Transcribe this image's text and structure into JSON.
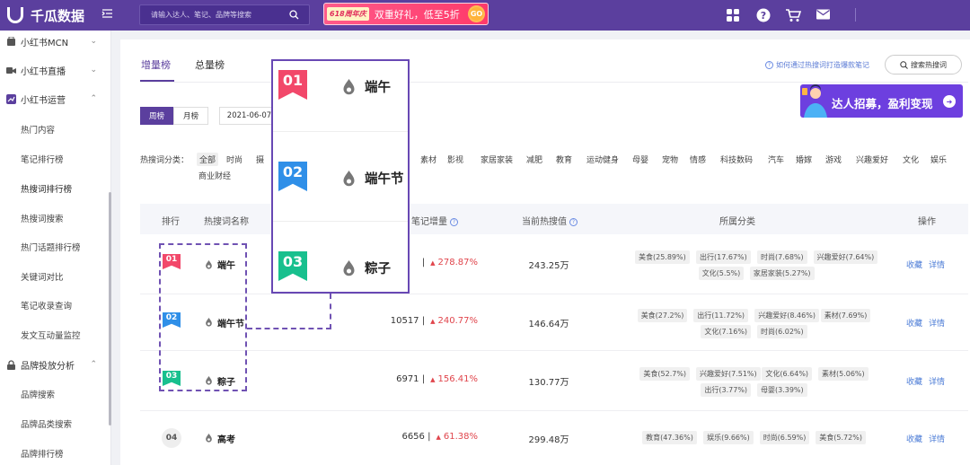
{
  "topbar": {
    "brand": "千瓜数据",
    "search_placeholder": "请输入达人、笔记、品牌等搜索",
    "promo_tag": "618周年庆",
    "promo_text": "双重好礼，低至5折",
    "promo_go": "GO",
    "icons": [
      "collapse-icon",
      "search-icon",
      "apps-icon",
      "help-icon",
      "cart-icon",
      "mail-icon"
    ]
  },
  "sidebar": {
    "groups": [
      {
        "label": "小红书MCN",
        "icon": "mcn-icon",
        "chevron": "⌄"
      },
      {
        "label": "小红书直播",
        "icon": "video-icon",
        "chevron": "⌄"
      },
      {
        "label": "小红书运营",
        "icon": "chart-icon",
        "chevron": "⌃"
      },
      {
        "label": "品牌投放分析",
        "icon": "lock-icon",
        "chevron": "⌃"
      }
    ],
    "items": [
      "热门内容",
      "笔记排行榜",
      "热搜词排行榜",
      "热搜词搜索",
      "热门话题排行榜",
      "关键词对比",
      "笔记收录查询",
      "发文互动量监控",
      "品牌搜索",
      "品牌品类搜索",
      "品牌排行榜"
    ]
  },
  "main": {
    "tabs": [
      "增量榜",
      "总量榜"
    ],
    "howto": "如何通过热搜词打造爆款笔记",
    "hot_search_btn": "搜索热搜词",
    "period": {
      "week": "周榜",
      "month": "月榜",
      "date": "2021-06-07"
    },
    "banner_text": "达人招募，盈利变现",
    "category_label": "热搜词分类：",
    "categories_left": [
      "全部",
      "时尚",
      "摄"
    ],
    "categories_right": [
      "素材",
      "影视",
      "家居家装",
      "减肥",
      "教育",
      "运动健身",
      "母婴",
      "宠物",
      "情感",
      "科技数码",
      "汽车",
      "婚嫁",
      "游戏",
      "兴趣爱好",
      "文化",
      "娱乐"
    ],
    "categories_row2": [
      "商业财经"
    ],
    "headers": {
      "rank": "排行",
      "keyword": "热搜词名称",
      "notes": "笔记增量",
      "heat": "当前热搜值",
      "category": "所属分类",
      "action": "操作"
    },
    "rows": [
      {
        "rank": "01",
        "color": "#f2486a",
        "keyword": "端午",
        "notes": "",
        "pct": "278.87%",
        "heat": "243.25万",
        "chips": [
          [
            "美食(25.89%)",
            "出行(17.67%)",
            "时尚(7.68%)",
            "兴趣爱好(7.64%)"
          ],
          [
            "文化(5.5%)",
            "家居家装(5.27%)"
          ]
        ]
      },
      {
        "rank": "02",
        "color": "#2f8fe8",
        "keyword": "端午节",
        "notes": "10517",
        "pct": "240.77%",
        "heat": "146.64万",
        "chips": [
          [
            "美食(27.2%)",
            "出行(11.72%)",
            "兴趣爱好(8.46%)",
            "素材(7.69%)"
          ],
          [
            "文化(7.16%)",
            "时尚(6.02%)"
          ]
        ]
      },
      {
        "rank": "03",
        "color": "#18c08e",
        "keyword": "粽子",
        "notes": "6971",
        "pct": "156.41%",
        "heat": "130.77万",
        "chips": [
          [
            "美食(52.7%)",
            "兴趣爱好(7.51%)",
            "文化(6.64%)",
            "素材(5.06%)"
          ],
          [
            "出行(3.77%)",
            "母婴(3.39%)"
          ]
        ]
      },
      {
        "rank": "04",
        "color": "#eeeeee",
        "keyword": "高考",
        "notes": "6656",
        "pct": "61.38%",
        "heat": "299.48万",
        "chips": [
          [
            "教育(47.36%)",
            "娱乐(9.66%)",
            "时尚(6.59%)",
            "美食(5.72%)"
          ]
        ]
      }
    ],
    "ops": {
      "collect": "收藏",
      "detail": "详情"
    },
    "separator": "|",
    "up_arrow": "▲"
  },
  "zoom": [
    {
      "rank": "01",
      "color": "#f2486a",
      "keyword": "端午"
    },
    {
      "rank": "02",
      "color": "#2f8fe8",
      "keyword": "端午节"
    },
    {
      "rank": "03",
      "color": "#18c08e",
      "keyword": "粽子"
    }
  ]
}
